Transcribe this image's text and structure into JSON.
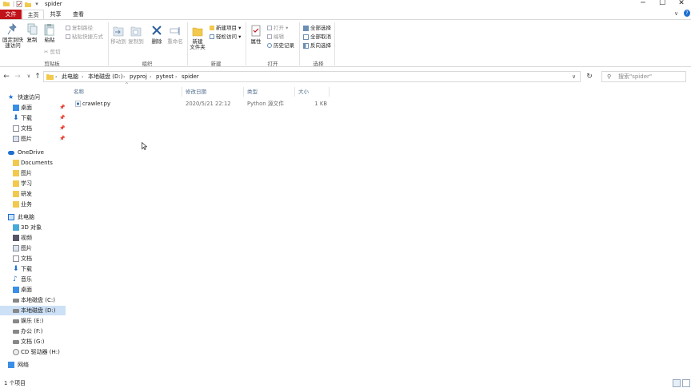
{
  "window": {
    "title": "spider"
  },
  "ribbon_tabs": [
    "文件",
    "主页",
    "共享",
    "查看"
  ],
  "clipboard": {
    "pin_label_1": "固定到快",
    "pin_label_2": "速访问",
    "copy": "复制",
    "paste": "粘贴",
    "copy_path": "复制路径",
    "paste_shortcut": "粘贴快捷方式",
    "cut": "剪切",
    "group": "剪贴板"
  },
  "organize": {
    "move_to": "移动到",
    "copy_to": "复制到",
    "delete": "删除",
    "rename": "重命名",
    "group": "组织"
  },
  "new_group": {
    "new_folder_1": "新建",
    "new_folder_2": "文件夹",
    "new_item": "新建项目",
    "easy_access": "轻松访问",
    "group": "新建"
  },
  "open_group": {
    "properties": "属性",
    "open": "打开",
    "edit": "编辑",
    "history": "历史记录",
    "group": "打开"
  },
  "select_group": {
    "select_all": "全部选择",
    "select_none": "全部取消",
    "invert": "反向选择",
    "group": "选择"
  },
  "address": {
    "crumbs": [
      "此电脑",
      "本地磁盘 (D:)",
      "pyproj",
      "pytest",
      "spider"
    ],
    "search_placeholder": "搜索\"spider\""
  },
  "nav": {
    "quick_access": "快速访问",
    "quick_items": [
      "桌面",
      "下载",
      "文档",
      "图片"
    ],
    "onedrive": "OneDrive",
    "onedrive_items": [
      "Documents",
      "图片",
      "学习",
      "研发",
      "业务"
    ],
    "this_pc": "此电脑",
    "pc_items": [
      "3D 对象",
      "视频",
      "图片",
      "文档",
      "下载",
      "音乐",
      "桌面",
      "本地磁盘 (C:)",
      "本地磁盘 (D:)",
      "娱乐 (E:)",
      "办公 (F:)",
      "文档 (G:)",
      "CD 驱动器 (H:)"
    ],
    "network": "网络"
  },
  "columns": {
    "name": "名称",
    "date": "修改日期",
    "type": "类型",
    "size": "大小"
  },
  "files": [
    {
      "name": "crawler.py",
      "date": "2020/5/21 22:12",
      "type": "Python 源文件",
      "size": "1 KB"
    }
  ],
  "status": {
    "count": "1 个项目"
  },
  "colors": {
    "file_tab": "#c1121a",
    "selection": "#cce0f6",
    "folder": "#f2c94c",
    "accent": "#1e6fd0"
  }
}
